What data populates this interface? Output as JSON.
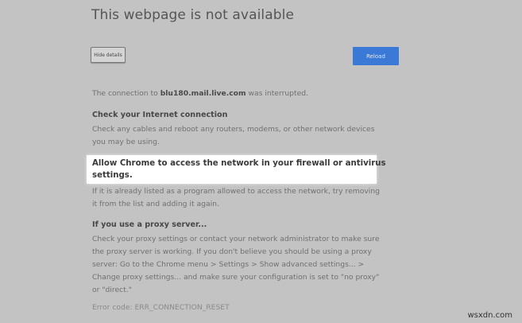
{
  "page": {
    "title": "This webpage is not available",
    "hide_details_label": "Hide details",
    "reload_label": "Reload",
    "connection_prefix": "The connection to ",
    "host": "blu180.mail.live.com",
    "connection_suffix": " was interrupted."
  },
  "sections": {
    "internet": {
      "heading": "Check your Internet connection",
      "lines": [
        "Check any cables and reboot any routers, modems, or other network devices",
        "you may be using."
      ]
    },
    "firewall": {
      "heading_lines": [
        "Allow Chrome to access the network in your firewall or antivirus",
        "settings."
      ],
      "lines": [
        "If it is already listed as a program allowed to access the network, try removing",
        "it from the list and adding it again."
      ]
    },
    "proxy": {
      "heading": "If you use a proxy server...",
      "lines": [
        "Check your proxy settings or contact your network administrator to make sure",
        "the proxy server is working. If you don't believe you should be using a proxy",
        "server: Go to the Chrome menu > Settings > Show advanced settings... >",
        "Change proxy settings... and make sure your configuration is set to \"no proxy\"",
        "or \"direct.\""
      ]
    }
  },
  "error_code": "Error code: ERR_CONNECTION_RESET",
  "watermark": "wsxdn.com",
  "colors": {
    "background": "#c3c3c3",
    "reload_button": "#3b79d6",
    "highlight": "#ffffff"
  }
}
